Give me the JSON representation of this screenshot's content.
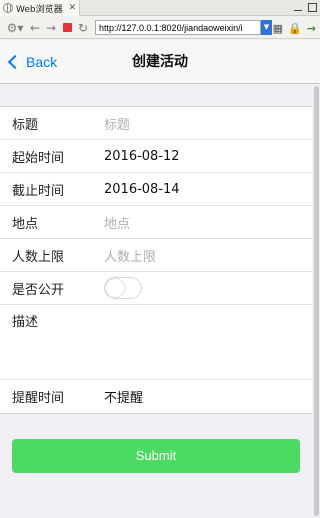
{
  "browser": {
    "tab_title": "Web浏览器",
    "tab_close": "✕",
    "url": "http://127.0.0.1:8020/jiandaoweixin/i"
  },
  "nav": {
    "back_label": "Back",
    "title": "创建活动"
  },
  "form": {
    "fields": [
      {
        "label": "标题",
        "placeholder": "标题"
      },
      {
        "label": "起始时间",
        "value": "2016-08-12"
      },
      {
        "label": "截止时间",
        "value": "2016-08-14"
      },
      {
        "label": "地点",
        "placeholder": "地点"
      },
      {
        "label": "人数上限",
        "placeholder": "人数上限"
      },
      {
        "label": "是否公开",
        "toggle_on": false
      },
      {
        "label": "描述"
      },
      {
        "label": "提醒时间",
        "value": "不提醒"
      }
    ]
  },
  "submit_label": "Submit",
  "colors": {
    "accent": "#007aff",
    "submit": "#4cd964"
  }
}
